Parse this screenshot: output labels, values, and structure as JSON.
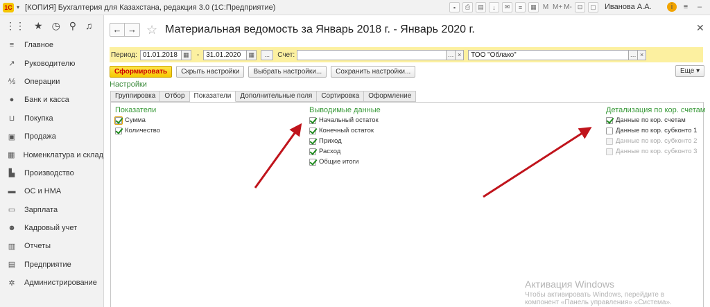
{
  "window": {
    "title": "[КОПИЯ] Бухгалтерия для Казахстана, редакция 3.0  (1С:Предприятие)",
    "user": "Иванова А.А.",
    "m_labels": [
      "M",
      "M+",
      "M-"
    ]
  },
  "sidebar": {
    "items": [
      {
        "label": "Главное",
        "icon": "menu-lines-icon"
      },
      {
        "label": "Руководителю",
        "icon": "trend-icon"
      },
      {
        "label": "Операции",
        "icon": "operations-icon"
      },
      {
        "label": "Банк и касса",
        "icon": "coin-icon"
      },
      {
        "label": "Покупка",
        "icon": "cart-icon"
      },
      {
        "label": "Продажа",
        "icon": "bag-icon"
      },
      {
        "label": "Номенклатура и склад",
        "icon": "grid-icon"
      },
      {
        "label": "Производство",
        "icon": "factory-icon"
      },
      {
        "label": "ОС и НМА",
        "icon": "truck-icon"
      },
      {
        "label": "Зарплата",
        "icon": "wallet-icon"
      },
      {
        "label": "Кадровый учет",
        "icon": "people-icon"
      },
      {
        "label": "Отчеты",
        "icon": "chart-icon"
      },
      {
        "label": "Предприятие",
        "icon": "building-icon"
      },
      {
        "label": "Администрирование",
        "icon": "gear-icon"
      }
    ]
  },
  "header": {
    "title": "Материальная ведомость  за Январь 2018 г. - Январь 2020 г."
  },
  "period": {
    "label": "Период:",
    "from": "01.01.2018",
    "separator": "-",
    "to": "31.01.2020",
    "dots": "...",
    "account_label": "Счет:",
    "account_value": "",
    "organization": "ТОО \"Облако\""
  },
  "toolbar": {
    "generate": "Сформировать",
    "hide_settings": "Скрыть настройки",
    "choose_settings": "Выбрать настройки...",
    "save_settings": "Сохранить настройки...",
    "more": "Еще"
  },
  "settings": {
    "title": "Настройки",
    "tabs": [
      "Группировка",
      "Отбор",
      "Показатели",
      "Дополнительные поля",
      "Сортировка",
      "Оформление"
    ],
    "active_tab": "Показатели",
    "indicators": {
      "title": "Показатели",
      "items": [
        {
          "label": "Сумма",
          "checked": true
        },
        {
          "label": "Количество",
          "checked": true
        }
      ]
    },
    "output": {
      "title": "Выводимые данные",
      "items": [
        {
          "label": "Начальный остаток",
          "checked": true
        },
        {
          "label": "Конечный остаток",
          "checked": true
        },
        {
          "label": "Приход",
          "checked": true
        },
        {
          "label": "Расход",
          "checked": true
        },
        {
          "label": "Общие итоги",
          "checked": true
        }
      ]
    },
    "detail": {
      "title": "Детализация по кор. счетам",
      "items": [
        {
          "label": "Данные по кор. счетам",
          "checked": true,
          "enabled": true
        },
        {
          "label": "Данные по кор. субконто 1",
          "checked": false,
          "enabled": true
        },
        {
          "label": "Данные по кор. субконто 2",
          "checked": false,
          "enabled": false
        },
        {
          "label": "Данные по кор. субконто 3",
          "checked": false,
          "enabled": false
        }
      ]
    }
  },
  "watermark": {
    "line1": "Активация Windows",
    "line2": "Чтобы активировать Windows, перейдите в",
    "line3": "компонент «Панель управления» «Система»."
  },
  "colors": {
    "annotation_arrow": "#c0141c",
    "group_title": "#3a9a3a",
    "period_bar": "#fcf0a0",
    "primary_button": "#f5c800"
  }
}
